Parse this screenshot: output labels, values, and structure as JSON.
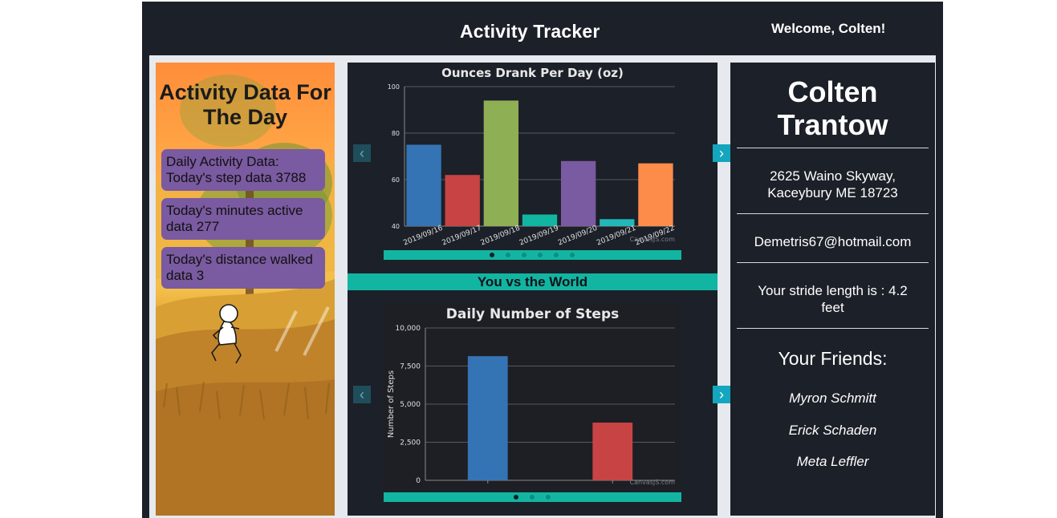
{
  "header": {
    "title": "Activity Tracker",
    "welcome": "Welcome, Colten!"
  },
  "activity": {
    "title": "Activity Data For The Day",
    "cards": [
      {
        "line1": "Daily Activity Data:",
        "line2": "Today's step data 3788"
      },
      {
        "line1": "Today's minutes active",
        "line2": "data 277"
      },
      {
        "line1": "Today's distance walked",
        "line2": "data 3"
      }
    ]
  },
  "middle": {
    "vs_label": "You vs the World",
    "nav_prev": "‹",
    "nav_next": "›"
  },
  "chart_data": [
    {
      "type": "bar",
      "title": "Ounces Drank Per Day (oz)",
      "categories": [
        "2019/09/16",
        "2019/09/17",
        "2019/09/18",
        "2019/09/19",
        "2019/09/20",
        "2019/09/21",
        "2019/09/22"
      ],
      "values": [
        75,
        62,
        94,
        45,
        68,
        43,
        67
      ],
      "colors": [
        "#3574b4",
        "#c84444",
        "#8faf55",
        "#12b5a2",
        "#7a5aa0",
        "#22b8ba",
        "#fd8c4a"
      ],
      "ylim": [
        40,
        100
      ],
      "yticks": [
        40,
        60,
        80,
        100
      ],
      "xlabel": "",
      "ylabel": "",
      "grid": true,
      "watermark": "CanvasJS.com",
      "carousel_dots": 6,
      "active_dot": 0
    },
    {
      "type": "bar",
      "title": "Daily Number of Steps",
      "categories": [
        "",
        ""
      ],
      "values": [
        8150,
        3788
      ],
      "colors": [
        "#3574b4",
        "#c84444"
      ],
      "ylim": [
        0,
        10000
      ],
      "yticks": [
        "0",
        "2,500",
        "5,000",
        "7,500",
        "10,000"
      ],
      "ytick_values": [
        0,
        2500,
        5000,
        7500,
        10000
      ],
      "xlabel": "",
      "ylabel": "Number of Steps",
      "grid": true,
      "watermark": "CanvasJS.com",
      "carousel_dots": 3,
      "active_dot": 0
    }
  ],
  "profile": {
    "name_line1": "Colten",
    "name_line2": "Trantow",
    "address_line1": "2625 Waino Skyway,",
    "address_line2": "Kaceybury ME 18723",
    "email": "Demetris67@hotmail.com",
    "stride_line1": "Your stride length is : 4.2",
    "stride_line2": "feet",
    "friends_title": "Your Friends:",
    "friends": [
      "Myron Schmitt",
      "Erick Schaden",
      "Meta Leffler"
    ]
  },
  "colors": {
    "background": "#1c2028",
    "accent": "#12b5a2",
    "card": "#7a5aa0"
  }
}
